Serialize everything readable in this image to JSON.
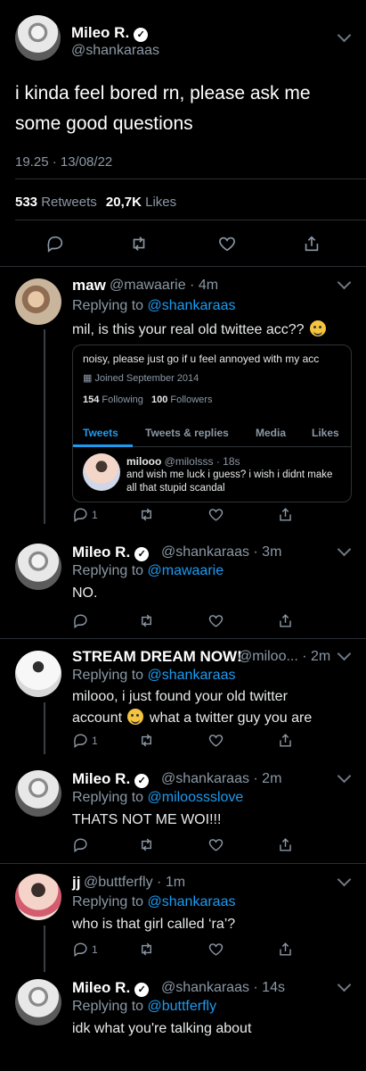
{
  "main_tweet": {
    "name": "Mileo R.",
    "handle": "@shankaraas",
    "text": "i kinda feel bored rn, please ask me some good questions",
    "time": "19.25 · 13/08/22",
    "retweets": "533",
    "retweets_label": "Retweets",
    "likes": "20,7K",
    "likes_label": "Likes",
    "icons": [
      "reply-icon",
      "retweet-icon",
      "like-icon",
      "share-icon"
    ]
  },
  "replies": [
    {
      "name": "maw",
      "handle": "@mawaarie · 4m",
      "replying_prefix": "Replying to",
      "replying_to": "@shankaraas",
      "text": "mil, is this your real old twittee acc?? ",
      "reply_count": "1",
      "card": {
        "bio": "noisy, please just go if u feel annoyed with my acc",
        "joined": "Joined September 2014",
        "following_count": "154",
        "following_label": "Following",
        "followers_count": "100",
        "followers_label": "Followers",
        "tabs": [
          "Tweets",
          "Tweets & replies",
          "Media",
          "Likes"
        ],
        "mini_tweet": {
          "name": "milooo",
          "handle": "@milolsss · 18s",
          "text": "and wish me luck i guess? i wish i didnt make all that stupid scandal"
        }
      }
    },
    {
      "name": "Mileo R.",
      "handle": "@shankaraas · 3m",
      "replying_prefix": "Replying to",
      "replying_to": "@mawaarie",
      "text": "NO."
    },
    {
      "name": "STREAM DREAM NOW!",
      "handle": "@miloo... · 2m",
      "replying_prefix": "Replying to",
      "replying_to": "@shankaraas",
      "text_1": "milooo, i just found your old twitter",
      "text_2a": "account ",
      "text_2b": " what a twitter guy you are",
      "reply_count": "1"
    },
    {
      "name": "Mileo R.",
      "handle": "@shankaraas · 2m",
      "replying_prefix": "Replying to",
      "replying_to": "@miloossslove",
      "text": "THATS NOT ME WOI!!!"
    },
    {
      "name": "jj",
      "handle": "@buttferfly · 1m",
      "replying_prefix": "Replying to",
      "replying_to": "@shankaraas",
      "text": "who is that girl called ‘ra’?",
      "reply_count": "1"
    },
    {
      "name": "Mileo R.",
      "handle": "@shankaraas · 14s",
      "replying_prefix": "Replying to",
      "replying_to": "@buttferfly",
      "text": "idk what you're talking about"
    }
  ],
  "colors": {
    "background": "#000000",
    "link": "#1d9bf0",
    "muted": "#8b98a5",
    "text": "#e7e9ea"
  }
}
